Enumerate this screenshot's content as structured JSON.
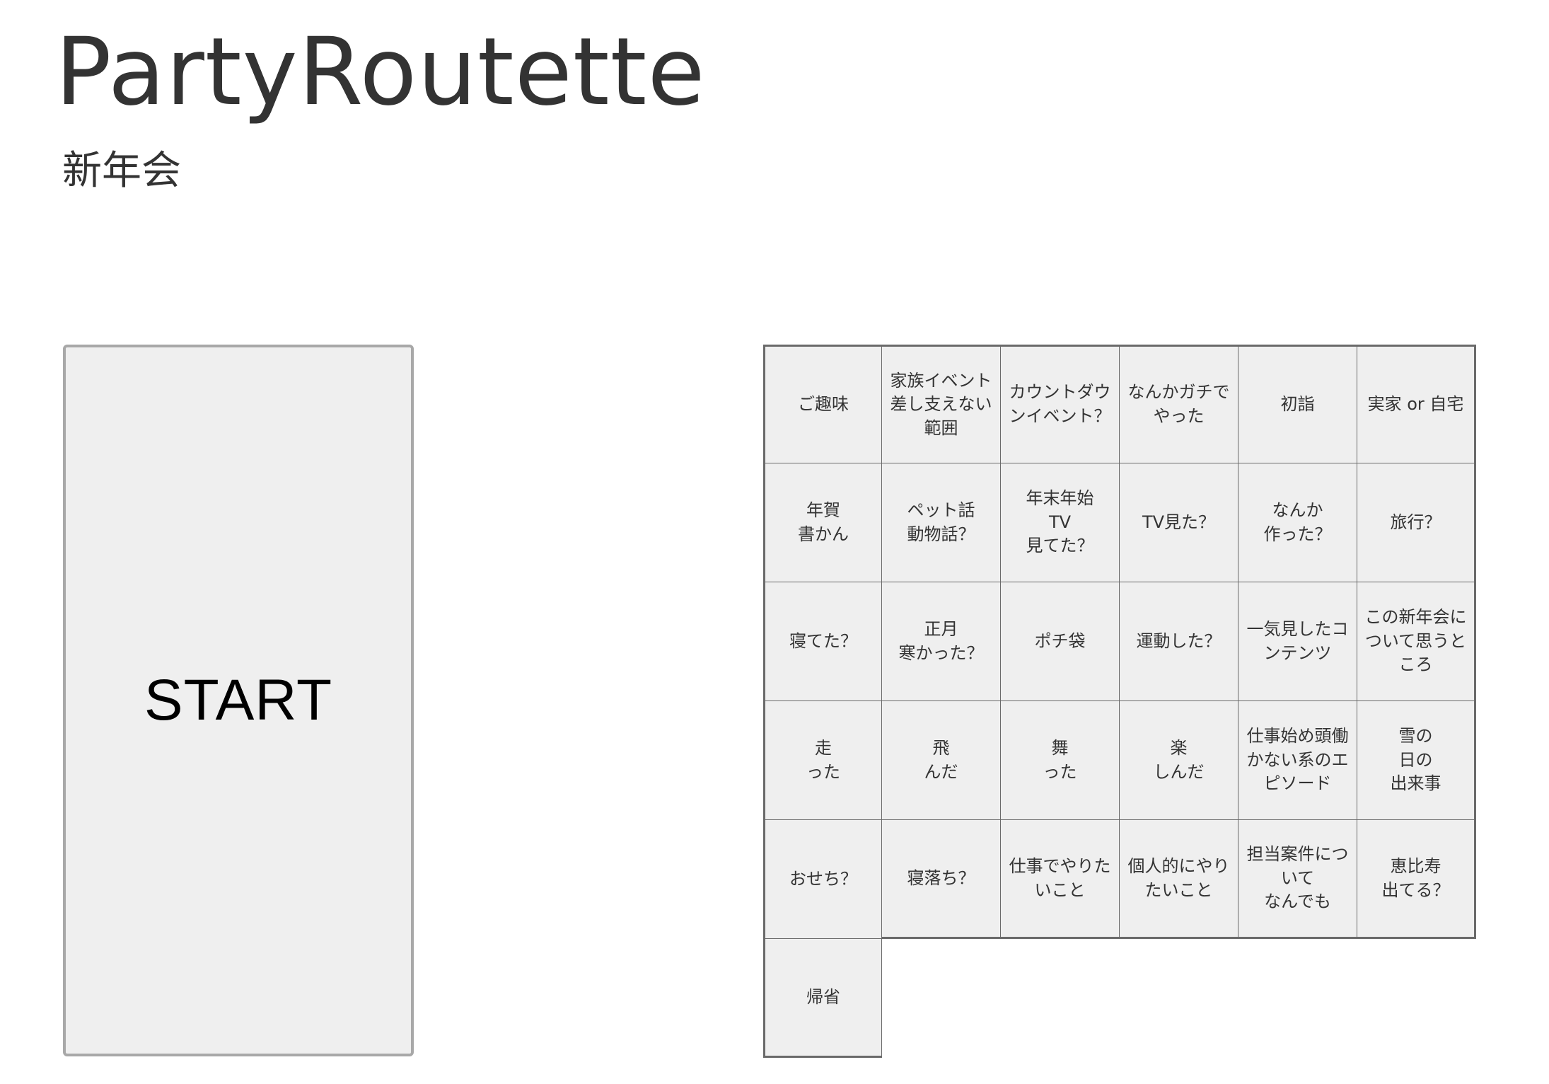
{
  "app": {
    "title": "PartyRoutette",
    "subtitle": "新年会"
  },
  "start": {
    "label": "START"
  },
  "grid": {
    "columns": 6,
    "topics": [
      "ご趣味",
      "家族イベント\n差し支えない範囲",
      "カウントダウンイベント？",
      "なんかガチでやった",
      "初詣",
      "実家 or 自宅",
      "年賀\n書かん",
      "ペット話\n動物話？",
      "年末年始\nTV\n見てた？",
      "TV見た？",
      "なんか\n作った？",
      "旅行？",
      "寝てた？",
      "正月\n寒かった？",
      "ポチ袋",
      "運動した？",
      "一気見したコンテンツ",
      "この新年会について思うところ",
      "走\nった",
      "飛\nんだ",
      "舞\nった",
      "楽\nしんだ",
      "仕事始め頭働かない系のエピソード",
      "雪の\n日の\n出来事",
      "おせち？",
      "寝落ち？",
      "仕事でやりたいこと",
      "個人的にやりたいこと",
      "担当案件について\nなんでも",
      "恵比寿\n出てる？",
      "帰省"
    ]
  },
  "colors": {
    "background": "#ffffff",
    "text": "#333333",
    "cell_fill": "#efefef",
    "grid_line": "#6a6a6a",
    "start_border": "#a8a8a8"
  }
}
